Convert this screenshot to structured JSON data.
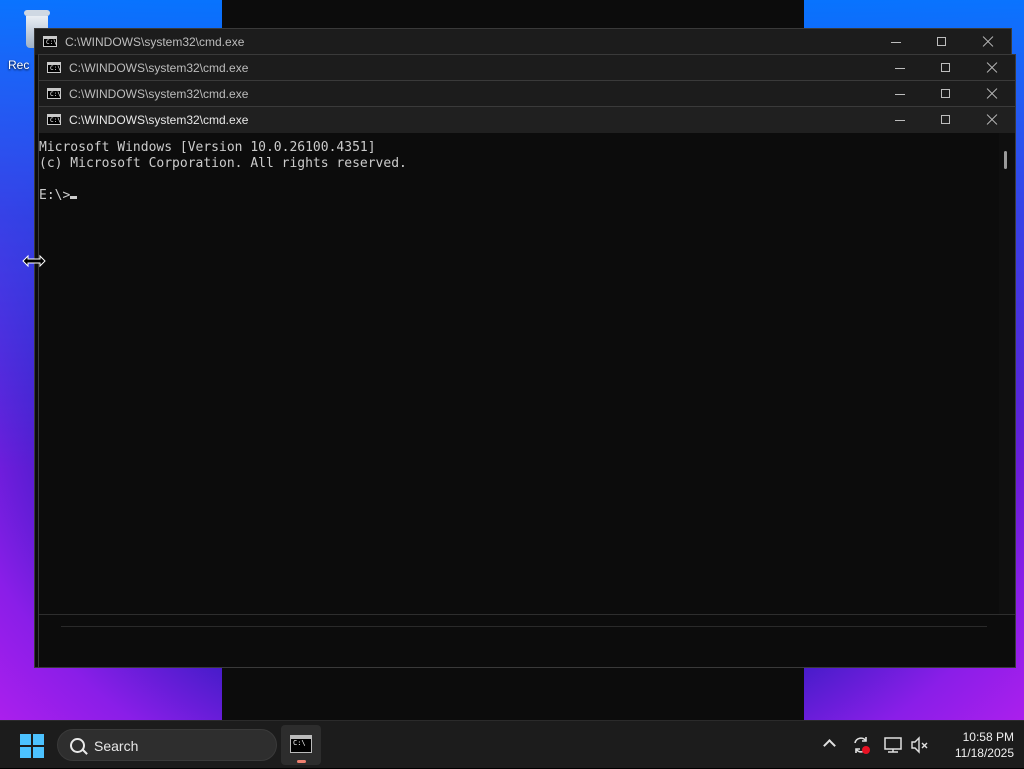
{
  "desktop": {
    "recycle_bin_label": "Rec"
  },
  "windows": [
    {
      "title": "C:\\WINDOWS\\system32\\cmd.exe",
      "icon": "C:\\"
    },
    {
      "title": "C:\\WINDOWS\\system32\\cmd.exe",
      "icon": "C:\\"
    },
    {
      "title": "C:\\WINDOWS\\system32\\cmd.exe",
      "icon": "C:\\"
    },
    {
      "title": "C:\\WINDOWS\\system32\\cmd.exe",
      "icon": "C:\\"
    }
  ],
  "console": {
    "line1": "Microsoft Windows [Version 10.0.26100.4351]",
    "line2": "(c) Microsoft Corporation. All rights reserved.",
    "line3": "",
    "prompt": "E:\\>"
  },
  "taskbar": {
    "search_label": "Search",
    "app_icon_text": "C:\\",
    "time": "10:58 PM",
    "date": "11/18/2025"
  },
  "icons": {
    "start": "windows-start-icon",
    "search": "search-icon",
    "tray": [
      "chevron-up-icon",
      "sync-icon",
      "network-icon",
      "volume-muted-icon"
    ]
  },
  "colors": {
    "console_bg": "#0c0c0c",
    "console_text": "#cccccc",
    "accent": "#4cc2ff",
    "notification": "#e81123"
  }
}
